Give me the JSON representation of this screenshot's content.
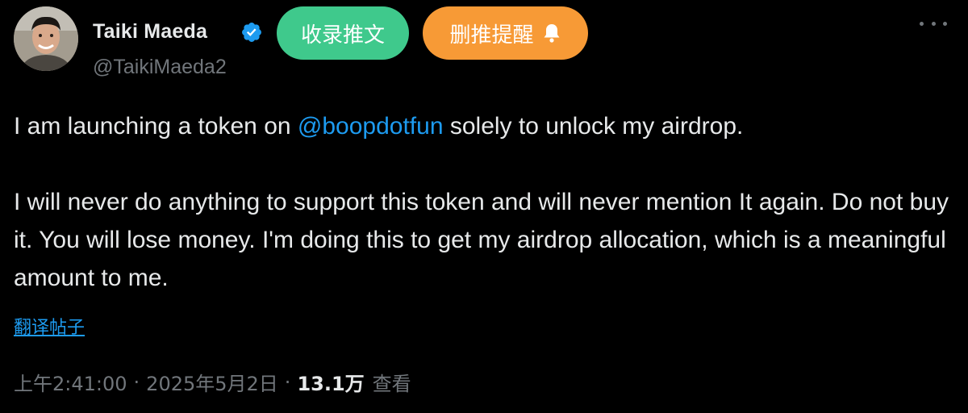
{
  "author": {
    "display_name": "Taiki Maeda",
    "handle": "@TaikiMaeda2",
    "verified": true
  },
  "actions": {
    "bookmark_label": "收录推文",
    "delete_reminder_label": "删推提醒"
  },
  "tweet": {
    "line1_before": "I am launching a token on ",
    "mention": "@boopdotfun",
    "line1_after": " solely to unlock my airdrop.",
    "paragraph2": "I will never do anything to support this token and will never mention It again. Do not buy it. You will lose money. I'm doing this to get my airdrop allocation, which is a meaningful amount to me."
  },
  "translate_label": "翻译帖子",
  "meta": {
    "time": "上午2:41:00",
    "separator": "·",
    "date": "2025年5月2日",
    "views_count": "13.1万",
    "views_label": "查看"
  },
  "colors": {
    "background": "#000000",
    "text": "#e7e9ea",
    "muted": "#71767b",
    "link": "#1d9bf0",
    "bookmark_button": "#3fc98c",
    "delete_button": "#f79a36",
    "verified_badge": "#1d9bf0"
  },
  "icons": {
    "verified": "verified-badge-icon",
    "bell": "bell-icon",
    "more": "more-dots-icon"
  }
}
